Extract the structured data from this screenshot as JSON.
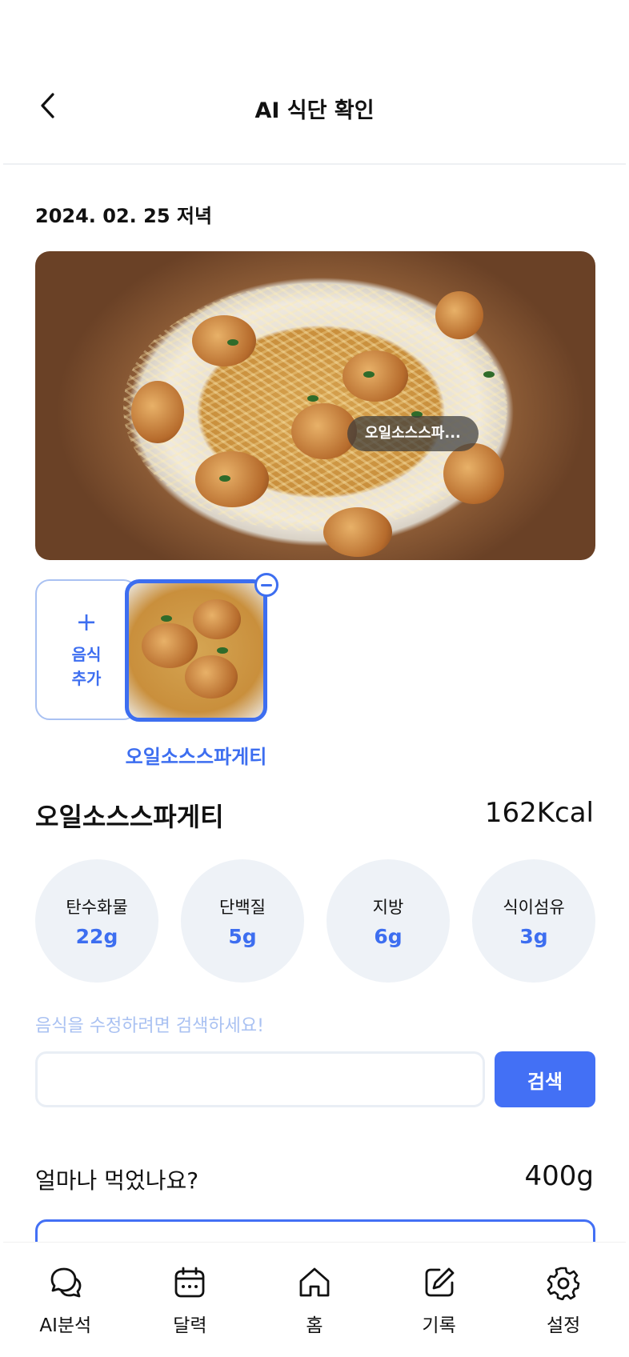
{
  "header": {
    "title": "AI 식단 확인",
    "back_icon": "chevron-left-icon"
  },
  "meal": {
    "date_label": "2024. 02. 25 저녁",
    "photo_tag": "오일소스스파..."
  },
  "foods": {
    "add_plus": "+",
    "add_label_line1": "음식",
    "add_label_line2": "추가",
    "selected_name": "오일소스스파게티"
  },
  "detail": {
    "name": "오일소스스파게티",
    "kcal": "162Kcal",
    "nutrients": [
      {
        "label": "탄수화물",
        "value": "22g"
      },
      {
        "label": "단백질",
        "value": "5g"
      },
      {
        "label": "지방",
        "value": "6g"
      },
      {
        "label": "식이섬유",
        "value": "3g"
      }
    ]
  },
  "search": {
    "hint": "음식을 수정하려면 검색하세요!",
    "value": "",
    "placeholder": "",
    "button_label": "검색"
  },
  "amount": {
    "question": "얼마나 먹었나요?",
    "value": "400g"
  },
  "tabbar": {
    "items": [
      {
        "label": "AI분석",
        "icon": "chat-bubbles-icon"
      },
      {
        "label": "달력",
        "icon": "calendar-icon"
      },
      {
        "label": "홈",
        "icon": "home-icon"
      },
      {
        "label": "기록",
        "icon": "edit-note-icon"
      },
      {
        "label": "설정",
        "icon": "gear-icon"
      }
    ]
  },
  "colors": {
    "accent": "#4370f5",
    "accent_light": "#a9c1f2",
    "nutrient_bg": "#eef2f7"
  }
}
